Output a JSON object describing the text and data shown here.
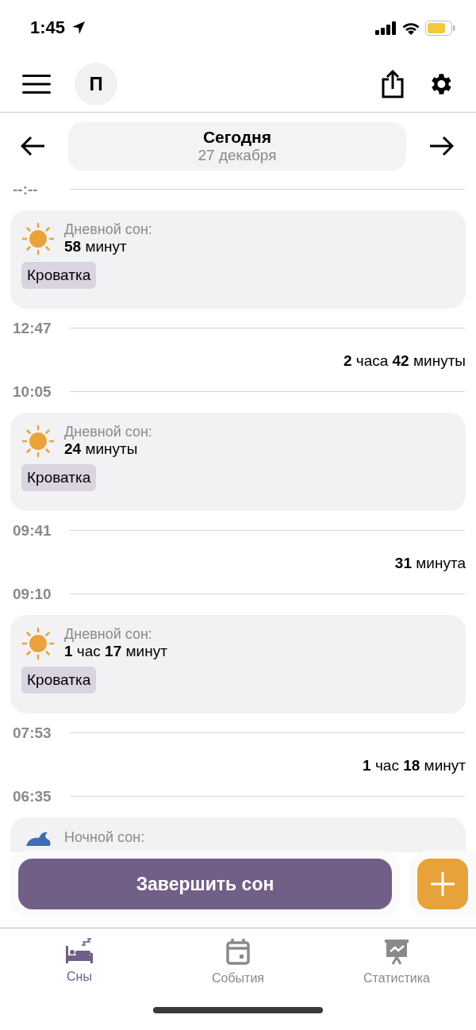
{
  "status_bar": {
    "time": "1:45"
  },
  "header": {
    "avatar_letter": "П"
  },
  "date_nav": {
    "title": "Сегодня",
    "date": "27 декабря"
  },
  "timeline": [
    {
      "kind": "time",
      "time": "--:--"
    },
    {
      "kind": "day_sleep",
      "title": "Дневной сон:",
      "duration": "**58** минут",
      "tag": "Кроватка"
    },
    {
      "kind": "time",
      "time": "12:47"
    },
    {
      "kind": "gap",
      "duration": "**2** часа **42** минуты"
    },
    {
      "kind": "time",
      "time": "10:05"
    },
    {
      "kind": "day_sleep",
      "title": "Дневной сон:",
      "duration": "**24** минуты",
      "tag": "Кроватка"
    },
    {
      "kind": "time",
      "time": "09:41"
    },
    {
      "kind": "gap",
      "duration": "**31** минута"
    },
    {
      "kind": "time",
      "time": "09:10"
    },
    {
      "kind": "day_sleep",
      "title": "Дневной сон:",
      "duration": "**1** час **17** минут",
      "tag": "Кроватка"
    },
    {
      "kind": "time",
      "time": "07:53"
    },
    {
      "kind": "gap",
      "duration": "**1** час **18** минут"
    },
    {
      "kind": "time",
      "time": "06:35"
    },
    {
      "kind": "night_sleep",
      "title": "Ночной сон:"
    }
  ],
  "actions": {
    "primary": "Завершить сон"
  },
  "tabs": [
    {
      "kind": "sleep",
      "label": "Сны",
      "selected": true
    },
    {
      "kind": "events",
      "label": "События",
      "selected": false
    },
    {
      "kind": "stats",
      "label": "Статистика",
      "selected": false
    }
  ]
}
